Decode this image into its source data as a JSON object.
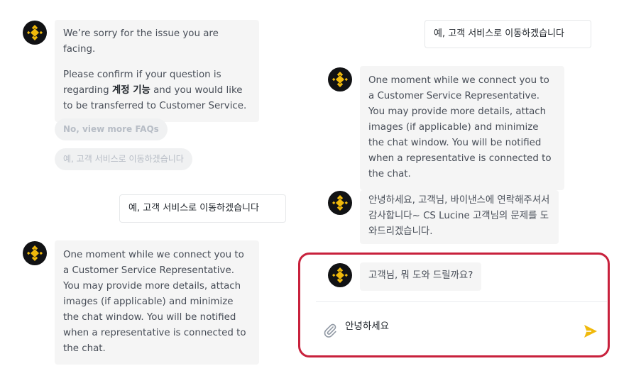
{
  "left_chat": {
    "msg1_line1": "We’re sorry for the issue you are facing.",
    "msg1_line2_prefix": "Please confirm if your question is regarding ",
    "msg1_highlight": "계정 기능",
    "msg1_line2_suffix": " and you would like to be transferred to Customer Service.",
    "quick_replies": [
      "No, view more FAQs",
      "예, 고객 서비스로 이동하겠습니다"
    ],
    "user_msg": "예, 고객 서비스로 이동하겠습니다",
    "msg2": "One moment while we connect you to a Customer Service Representative. You may provide more details, attach images (if applicable) and minimize the chat window. You will be notified when a representative is connected to the chat."
  },
  "right_chat": {
    "user_msg": "예, 고객 서비스로 이동하겠습니다",
    "msg1": "One moment while we connect you to a Customer Service Representative. You may provide more details, attach images (if applicable) and minimize the chat window. You will be notified when a representative is connected to the chat.",
    "msg2": "안녕하세요, 고객님, 바이낸스에 연락해주셔서 감사합니다~ CS Lucine 고객님의 문제를 도와드리겠습니다.",
    "msg3": "고객님, 뭐 도와 드릴까요?"
  },
  "composer": {
    "input_value": "안녕하세요"
  },
  "colors": {
    "brand": "#f0b90b",
    "highlight_border": "#c8213c"
  },
  "icons": {
    "avatar": "binance-logo-icon",
    "attach": "paperclip-icon",
    "send": "send-icon"
  }
}
